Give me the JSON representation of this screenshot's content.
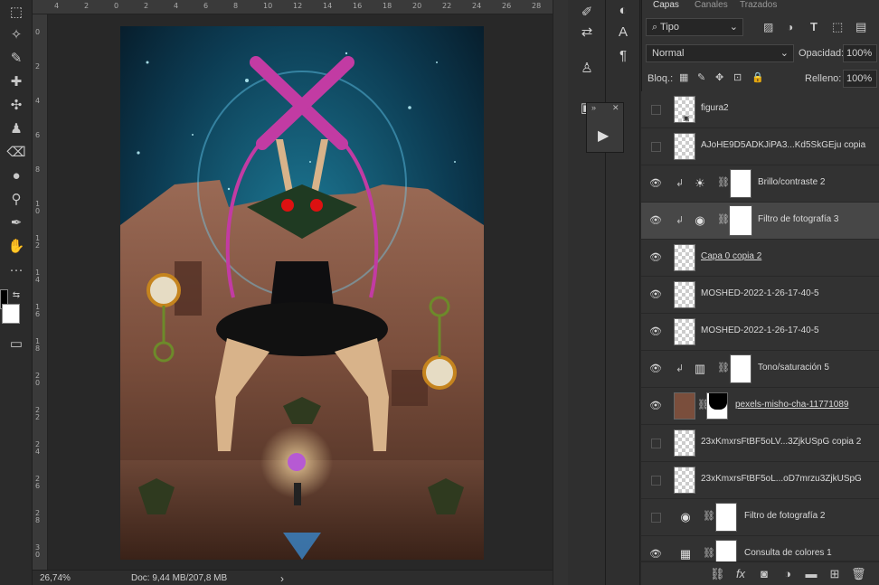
{
  "ruler": {
    "top_ticks": [
      "4",
      "2",
      "0",
      "2",
      "4",
      "6",
      "8",
      "10",
      "12",
      "14",
      "16",
      "18",
      "20",
      "22",
      "24",
      "26",
      "28"
    ],
    "left_ticks": [
      "0",
      "2",
      "4",
      "6",
      "8",
      "10",
      "12",
      "14",
      "16",
      "18",
      "20",
      "22",
      "24",
      "26",
      "28",
      "30"
    ]
  },
  "status": {
    "zoom": "26,74%",
    "doc": "Doc: 9,44 MB/207,8 MB",
    "arrow": "›"
  },
  "panel_tabs": [
    "Capas",
    "Canales",
    "Trazados"
  ],
  "filter": {
    "kind": "Tipo"
  },
  "blend_mode": "Normal",
  "opacity": {
    "label": "Opacidad:",
    "value": "100%"
  },
  "lock": {
    "label": "Bloq.:"
  },
  "fill": {
    "label": "Relleno:",
    "value": "100%"
  },
  "layers": [
    {
      "name": "figura2",
      "visible": false,
      "kind": "smart"
    },
    {
      "name": "AJoHE9D5ADKJiPA3...Kd5SkGEju copia",
      "visible": false,
      "kind": "pixel"
    },
    {
      "name": "Brillo/contraste 2",
      "visible": true,
      "kind": "adjustment",
      "icon": "brightness-icon"
    },
    {
      "name": "Filtro de fotografía 3",
      "visible": true,
      "kind": "adjustment",
      "icon": "photo-filter-icon",
      "selected": true
    },
    {
      "name": "Capa 0 copia 2",
      "visible": true,
      "kind": "pixel"
    },
    {
      "name": "MOSHED-2022-1-26-17-40-5",
      "visible": true,
      "kind": "pixel"
    },
    {
      "name": "MOSHED-2022-1-26-17-40-5",
      "visible": true,
      "kind": "pixel"
    },
    {
      "name": "Tono/saturación 5",
      "visible": true,
      "kind": "adjustment",
      "icon": "hue-saturation-icon"
    },
    {
      "name": "pexels-misho-cha-11771089",
      "visible": true,
      "kind": "masked"
    },
    {
      "name": "23xKmxrsFtBF5oLV...3ZjkUSpG copia 2",
      "visible": false,
      "kind": "pixel"
    },
    {
      "name": "23xKmxrsFtBF5oL...oD7mrzu3ZjkUSpG",
      "visible": false,
      "kind": "pixel"
    },
    {
      "name": "Filtro de fotografía 2",
      "visible": false,
      "kind": "adjustment",
      "icon": "photo-filter-icon"
    },
    {
      "name": "Consulta de colores 1",
      "visible": true,
      "kind": "adjustment",
      "icon": "color-lookup-icon"
    }
  ],
  "colors": {
    "foreground": "#000000",
    "background": "#ffffff",
    "selection": "#474747"
  }
}
